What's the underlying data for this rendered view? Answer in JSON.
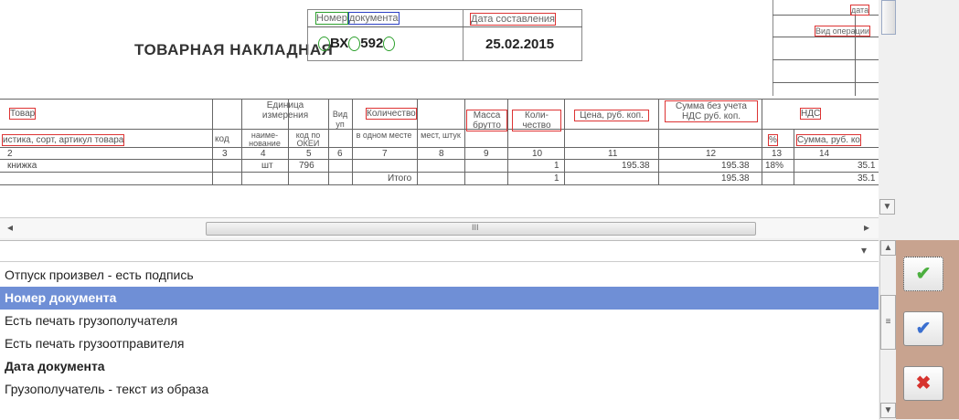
{
  "document": {
    "title": "ТОВАРНАЯ НАКЛАДНАЯ",
    "doc_number_label_a": "Номер",
    "doc_number_label_b": "документа",
    "doc_number_value_a": "ВХ",
    "doc_number_value_b": "592",
    "date_label": "Дата составления",
    "date_value": "25.02.2015",
    "right_labels": [
      "дата",
      "Вид операции"
    ]
  },
  "table": {
    "headers": {
      "tovar": "Товар",
      "tovar_sub": "истика, сорт, артикул товара",
      "kod": "код",
      "unit": "Единица измерения",
      "unit_name": "наиме-нование",
      "unit_okei": "код по ОКЕИ",
      "vid": "Вид уп",
      "qty": "Количество",
      "qty_one": "в одном месте",
      "qty_places": "мест, штук",
      "mass": "Масса брутто",
      "count": "Коли-чество",
      "price": "Цена, руб. коп.",
      "sum_no_vat": "Сумма без учета НДС руб. коп.",
      "vat": "НДС",
      "vat_rate": "%",
      "vat_sum": "Сумма, руб. ко"
    },
    "numbers": [
      "2",
      "3",
      "4",
      "5",
      "6",
      "7",
      "8",
      "9",
      "10",
      "11",
      "12",
      "13",
      "14"
    ],
    "row": {
      "name": "книжка",
      "unit": "шт",
      "okei": "796",
      "count": "1",
      "price": "195.38",
      "sum": "195.38",
      "rate": "18%",
      "vat": "35.1"
    },
    "total": {
      "label": "Итого",
      "count": "1",
      "sum": "195.38",
      "vat": "35.1"
    }
  },
  "hscroll": {
    "left_arrow": "◂",
    "grip": "III",
    "right_arrow": "▸"
  },
  "combo": {
    "arrow": "▾"
  },
  "list_items": [
    {
      "label": "Отпуск произвел - есть подпись",
      "style": "normal"
    },
    {
      "label": "Номер документа",
      "style": "selected"
    },
    {
      "label": "Есть печать грузополучателя",
      "style": "normal"
    },
    {
      "label": "Есть печать грузоотправителя",
      "style": "normal"
    },
    {
      "label": "Дата документа",
      "style": "bold"
    },
    {
      "label": "Грузополучатель - текст из образа",
      "style": "normal"
    }
  ],
  "vscroll": {
    "up": "▲",
    "grip": "≡",
    "down": "▼"
  },
  "actions": [
    {
      "icon": "check-mark-icon",
      "glyph": "✔",
      "color": "#4caf3f"
    },
    {
      "icon": "double-check-icon",
      "glyph": "✔",
      "color": "#3a6fd0"
    },
    {
      "icon": "red-x-icon",
      "glyph": "✖",
      "color": "#d6332e"
    }
  ]
}
